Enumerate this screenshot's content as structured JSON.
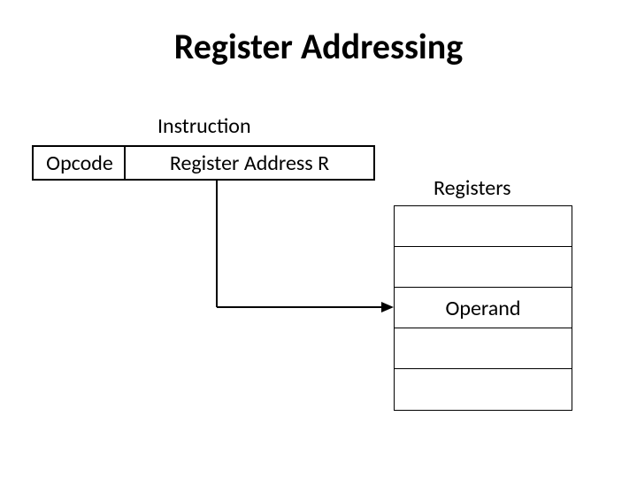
{
  "title": "Register Addressing",
  "instruction_label": "Instruction",
  "opcode_label": "Opcode",
  "register_field_label": "Register Address R",
  "registers_label": "Registers",
  "rows": [
    "",
    "",
    "Operand",
    "",
    ""
  ]
}
